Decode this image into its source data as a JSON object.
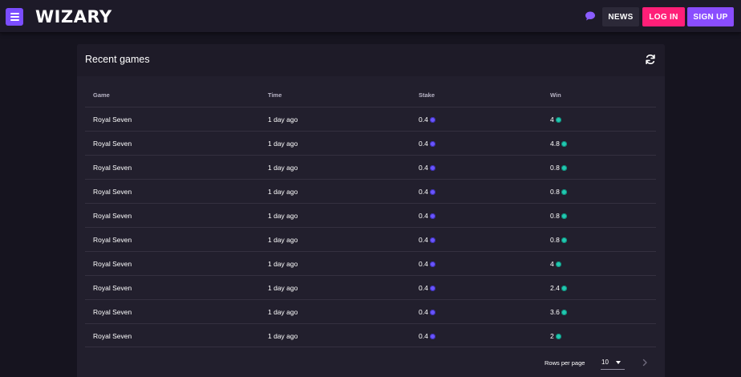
{
  "header": {
    "logo": "WIZARY",
    "news_label": "NEWS",
    "login_label": "LOG IN",
    "signup_label": "SIGN UP",
    "icons": {
      "menu": "hamburger-menu-icon",
      "chat": "chat-bubble-icon"
    }
  },
  "colors": {
    "accent_purple": "#7b4dff",
    "login_pink": "#ff1f78",
    "signup_purple": "#8a4dff",
    "stake_coin": "#6a55ff",
    "win_coin": "#22c8b0"
  },
  "recent_games": {
    "title": "Recent games",
    "refresh_icon": "refresh-icon",
    "columns": [
      "Game",
      "Time",
      "Stake",
      "Win"
    ],
    "rows": [
      {
        "game": "Royal Seven",
        "time": "1 day ago",
        "stake": "0.4",
        "win": "4"
      },
      {
        "game": "Royal Seven",
        "time": "1 day ago",
        "stake": "0.4",
        "win": "4.8"
      },
      {
        "game": "Royal Seven",
        "time": "1 day ago",
        "stake": "0.4",
        "win": "0.8"
      },
      {
        "game": "Royal Seven",
        "time": "1 day ago",
        "stake": "0.4",
        "win": "0.8"
      },
      {
        "game": "Royal Seven",
        "time": "1 day ago",
        "stake": "0.4",
        "win": "0.8"
      },
      {
        "game": "Royal Seven",
        "time": "1 day ago",
        "stake": "0.4",
        "win": "0.8"
      },
      {
        "game": "Royal Seven",
        "time": "1 day ago",
        "stake": "0.4",
        "win": "4"
      },
      {
        "game": "Royal Seven",
        "time": "1 day ago",
        "stake": "0.4",
        "win": "2.4"
      },
      {
        "game": "Royal Seven",
        "time": "1 day ago",
        "stake": "0.4",
        "win": "3.6"
      },
      {
        "game": "Royal Seven",
        "time": "1 day ago",
        "stake": "0.4",
        "win": "2"
      }
    ],
    "pagination": {
      "rows_per_page_label": "Rows per page",
      "rows_per_page_value": "10",
      "next_icon": "chevron-right-icon"
    }
  }
}
